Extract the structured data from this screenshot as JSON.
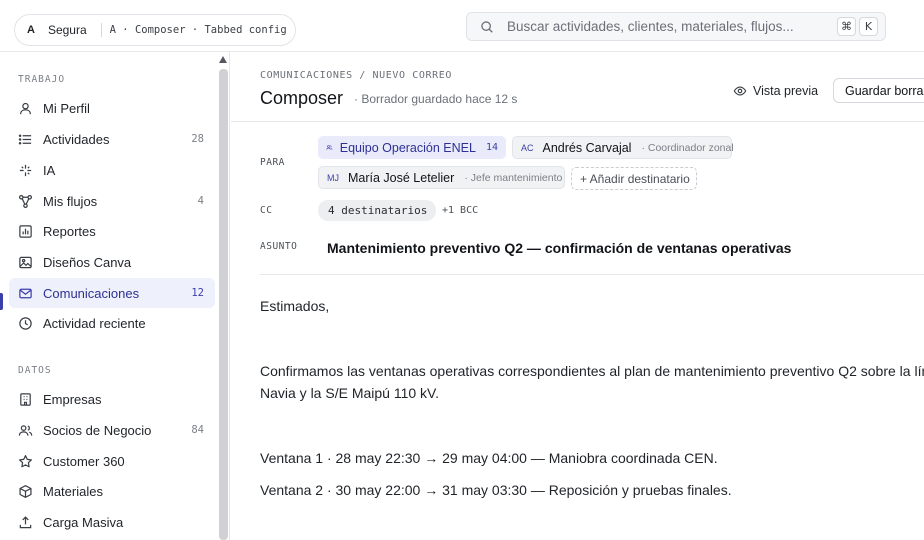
{
  "workspace": {
    "badge": "A",
    "name": "Segura",
    "path": "A · Composer · Tabbed config"
  },
  "search": {
    "placeholder": "Buscar actividades, clientes, materiales, flujos...",
    "shortcut_mod": "⌘",
    "shortcut_key": "K"
  },
  "sidebar": {
    "sections": [
      {
        "label": "TRABAJO",
        "items": [
          {
            "label": "Mi Perfil",
            "icon": "user-icon",
            "count": ""
          },
          {
            "label": "Actividades",
            "icon": "list-icon",
            "count": "28"
          },
          {
            "label": "IA",
            "icon": "sparkle-icon",
            "count": ""
          },
          {
            "label": "Mis flujos",
            "icon": "workflow-icon",
            "count": "4"
          },
          {
            "label": "Reportes",
            "icon": "chart-icon",
            "count": ""
          },
          {
            "label": "Diseños Canva",
            "icon": "image-icon",
            "count": ""
          },
          {
            "label": "Comunicaciones",
            "icon": "mail-icon",
            "count": "12",
            "active": true
          },
          {
            "label": "Actividad reciente",
            "icon": "clock-icon",
            "count": ""
          }
        ]
      },
      {
        "label": "DATOS",
        "items": [
          {
            "label": "Empresas",
            "icon": "building-icon",
            "count": ""
          },
          {
            "label": "Socios de Negocio",
            "icon": "users-icon",
            "count": "84"
          },
          {
            "label": "Customer 360",
            "icon": "star-icon",
            "count": ""
          },
          {
            "label": "Materiales",
            "icon": "box-icon",
            "count": ""
          },
          {
            "label": "Carga Masiva",
            "icon": "upload-icon",
            "count": ""
          }
        ]
      }
    ]
  },
  "main": {
    "breadcrumb": "COMUNICACIONES / NUEVO CORREO",
    "title": "Composer",
    "saved_status": "· Borrador guardado hace 12 s",
    "preview_label": "Vista previa",
    "save_label": "Guardar borrador",
    "to_label": "PARA",
    "recipients": {
      "group": {
        "name": "Equipo Operación ENEL",
        "count": "14"
      },
      "people": [
        {
          "initials": "AC",
          "name": "Andrés Carvajal",
          "role": "· Coordinador zonal"
        },
        {
          "initials": "MJ",
          "name": "María José Letelier",
          "role": "· Jefe mantenimiento"
        }
      ],
      "add_label": "+ Añadir destinatario"
    },
    "cc_label": "CC",
    "cc_value": "4 destinatarios",
    "bcc_value": "+1 BCC",
    "subject_label": "ASUNTO",
    "subject": "Mantenimiento preventivo Q2 — confirmación de ventanas operativas",
    "body": {
      "greeting": "Estimados,",
      "para1_line1": "Confirmamos las ventanas operativas correspondientes al plan de mantenimiento preventivo Q2 sobre la línea",
      "para1_line2": "Navia y la S/E Maipú 110 kV.",
      "window1": "Ventana 1 · 28 may 22:30 → 29 may 04:00 — Maniobra coordinada CEN.",
      "window2": "Ventana 2 · 30 may 22:00 → 31 may 03:30 — Reposición y pruebas finales."
    }
  },
  "colors": {
    "accent": "#3b3fa8",
    "active_bg": "#eef0fb",
    "chip_group_bg": "#e9ebfb"
  }
}
